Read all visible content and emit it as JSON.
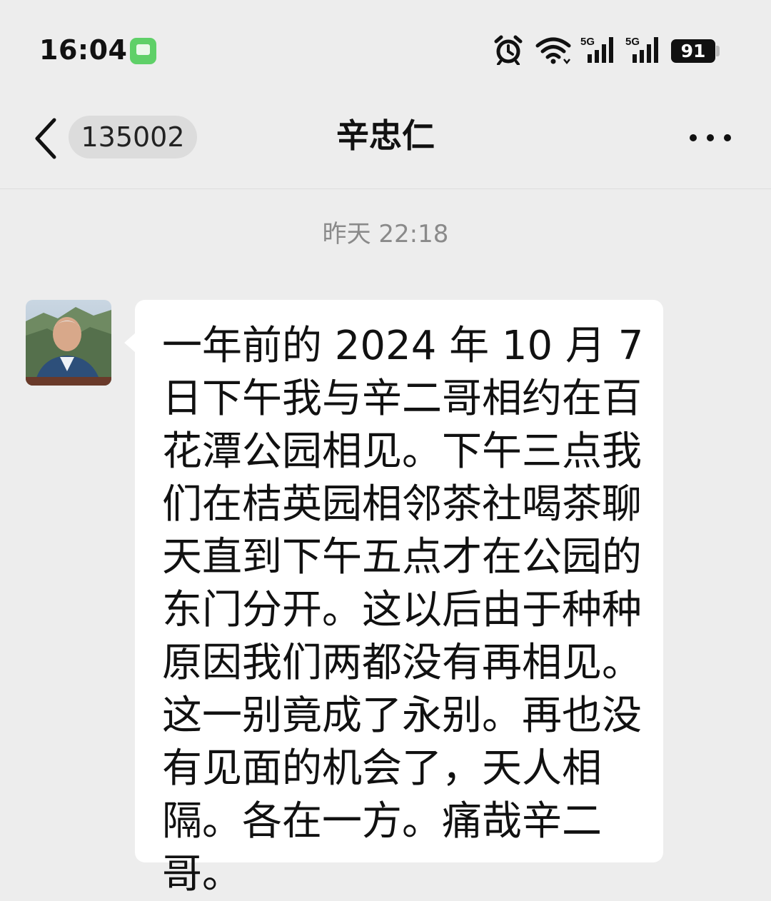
{
  "status_bar": {
    "time": "16:04",
    "battery_level": "91",
    "network": [
      "5G",
      "5G"
    ],
    "icons": [
      "message-notification-icon",
      "alarm-icon",
      "wifi-icon",
      "signal-icon",
      "battery-icon"
    ]
  },
  "nav": {
    "back_icon": "chevron-left-icon",
    "unread_count": "135002",
    "title": "辛忠仁",
    "more_icon": "more-dots-icon"
  },
  "chat": {
    "timestamp": "昨天 22:18",
    "message": {
      "text": "一年前的 2024 年 10 月 7 日下午我与辛二哥相约在百花潭公园相见。下午三点我们在桔英园相邻茶社喝茶聊天直到下午五点才在公园的东门分开。这以后由于种种原因我们两都没有再相见。这一别竟成了永别。再也没有见面的机会了，天人相隔。各在一方。痛哉辛二哥。"
    }
  },
  "colors": {
    "background": "#ededed",
    "bubble": "#ffffff",
    "timestamp": "#8a8a8a",
    "notification_green": "#5fd068"
  }
}
